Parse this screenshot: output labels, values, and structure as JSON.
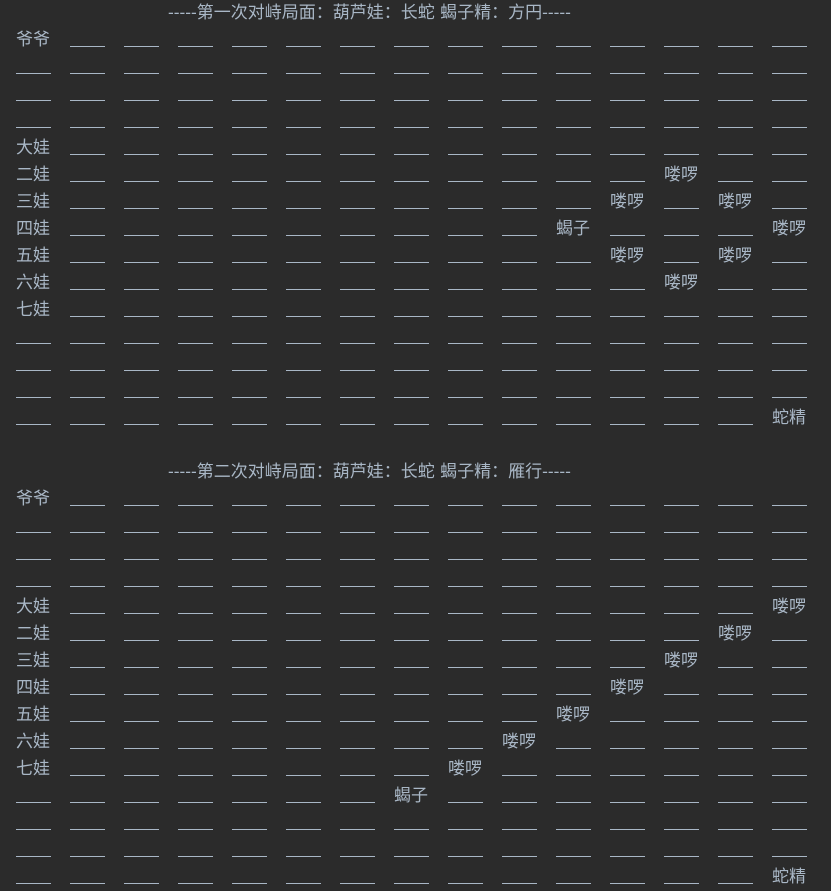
{
  "console": {
    "boards": [
      {
        "title": "-----第一次对峙局面：葫芦娃：长蛇     蝎子精：方円-----",
        "rows": [
          [
            "爷爷",
            "",
            "",
            "",
            "",
            "",
            "",
            "",
            "",
            "",
            "",
            "",
            "",
            "",
            ""
          ],
          [
            "",
            "",
            "",
            "",
            "",
            "",
            "",
            "",
            "",
            "",
            "",
            "",
            "",
            "",
            ""
          ],
          [
            "",
            "",
            "",
            "",
            "",
            "",
            "",
            "",
            "",
            "",
            "",
            "",
            "",
            "",
            ""
          ],
          [
            "",
            "",
            "",
            "",
            "",
            "",
            "",
            "",
            "",
            "",
            "",
            "",
            "",
            "",
            ""
          ],
          [
            "大娃",
            "",
            "",
            "",
            "",
            "",
            "",
            "",
            "",
            "",
            "",
            "",
            "",
            "",
            ""
          ],
          [
            "二娃",
            "",
            "",
            "",
            "",
            "",
            "",
            "",
            "",
            "",
            "",
            "",
            "喽啰",
            "",
            ""
          ],
          [
            "三娃",
            "",
            "",
            "",
            "",
            "",
            "",
            "",
            "",
            "",
            "",
            "喽啰",
            "",
            "喽啰",
            ""
          ],
          [
            "四娃",
            "",
            "",
            "",
            "",
            "",
            "",
            "",
            "",
            "",
            "蝎子",
            "",
            "",
            "",
            "喽啰"
          ],
          [
            "五娃",
            "",
            "",
            "",
            "",
            "",
            "",
            "",
            "",
            "",
            "",
            "喽啰",
            "",
            "喽啰",
            ""
          ],
          [
            "六娃",
            "",
            "",
            "",
            "",
            "",
            "",
            "",
            "",
            "",
            "",
            "",
            "喽啰",
            "",
            ""
          ],
          [
            "七娃",
            "",
            "",
            "",
            "",
            "",
            "",
            "",
            "",
            "",
            "",
            "",
            "",
            "",
            ""
          ],
          [
            "",
            "",
            "",
            "",
            "",
            "",
            "",
            "",
            "",
            "",
            "",
            "",
            "",
            "",
            ""
          ],
          [
            "",
            "",
            "",
            "",
            "",
            "",
            "",
            "",
            "",
            "",
            "",
            "",
            "",
            "",
            ""
          ],
          [
            "",
            "",
            "",
            "",
            "",
            "",
            "",
            "",
            "",
            "",
            "",
            "",
            "",
            "",
            ""
          ],
          [
            "",
            "",
            "",
            "",
            "",
            "",
            "",
            "",
            "",
            "",
            "",
            "",
            "",
            "",
            "蛇精"
          ]
        ]
      },
      {
        "title": "-----第二次对峙局面：葫芦娃：长蛇     蝎子精：雁行-----",
        "rows": [
          [
            "爷爷",
            "",
            "",
            "",
            "",
            "",
            "",
            "",
            "",
            "",
            "",
            "",
            "",
            "",
            ""
          ],
          [
            "",
            "",
            "",
            "",
            "",
            "",
            "",
            "",
            "",
            "",
            "",
            "",
            "",
            "",
            ""
          ],
          [
            "",
            "",
            "",
            "",
            "",
            "",
            "",
            "",
            "",
            "",
            "",
            "",
            "",
            "",
            ""
          ],
          [
            "",
            "",
            "",
            "",
            "",
            "",
            "",
            "",
            "",
            "",
            "",
            "",
            "",
            "",
            ""
          ],
          [
            "大娃",
            "",
            "",
            "",
            "",
            "",
            "",
            "",
            "",
            "",
            "",
            "",
            "",
            "",
            "喽啰"
          ],
          [
            "二娃",
            "",
            "",
            "",
            "",
            "",
            "",
            "",
            "",
            "",
            "",
            "",
            "",
            "喽啰",
            ""
          ],
          [
            "三娃",
            "",
            "",
            "",
            "",
            "",
            "",
            "",
            "",
            "",
            "",
            "",
            "喽啰",
            "",
            ""
          ],
          [
            "四娃",
            "",
            "",
            "",
            "",
            "",
            "",
            "",
            "",
            "",
            "",
            "喽啰",
            "",
            "",
            ""
          ],
          [
            "五娃",
            "",
            "",
            "",
            "",
            "",
            "",
            "",
            "",
            "",
            "喽啰",
            "",
            "",
            "",
            ""
          ],
          [
            "六娃",
            "",
            "",
            "",
            "",
            "",
            "",
            "",
            "",
            "喽啰",
            "",
            "",
            "",
            "",
            ""
          ],
          [
            "七娃",
            "",
            "",
            "",
            "",
            "",
            "",
            "",
            "喽啰",
            "",
            "",
            "",
            "",
            "",
            ""
          ],
          [
            "",
            "",
            "",
            "",
            "",
            "",
            "",
            "蝎子",
            "",
            "",
            "",
            "",
            "",
            "",
            ""
          ],
          [
            "",
            "",
            "",
            "",
            "",
            "",
            "",
            "",
            "",
            "",
            "",
            "",
            "",
            "",
            ""
          ],
          [
            "",
            "",
            "",
            "",
            "",
            "",
            "",
            "",
            "",
            "",
            "",
            "",
            "",
            "",
            ""
          ],
          [
            "",
            "",
            "",
            "",
            "",
            "",
            "",
            "",
            "",
            "",
            "",
            "",
            "",
            "",
            "蛇精"
          ]
        ]
      }
    ]
  }
}
